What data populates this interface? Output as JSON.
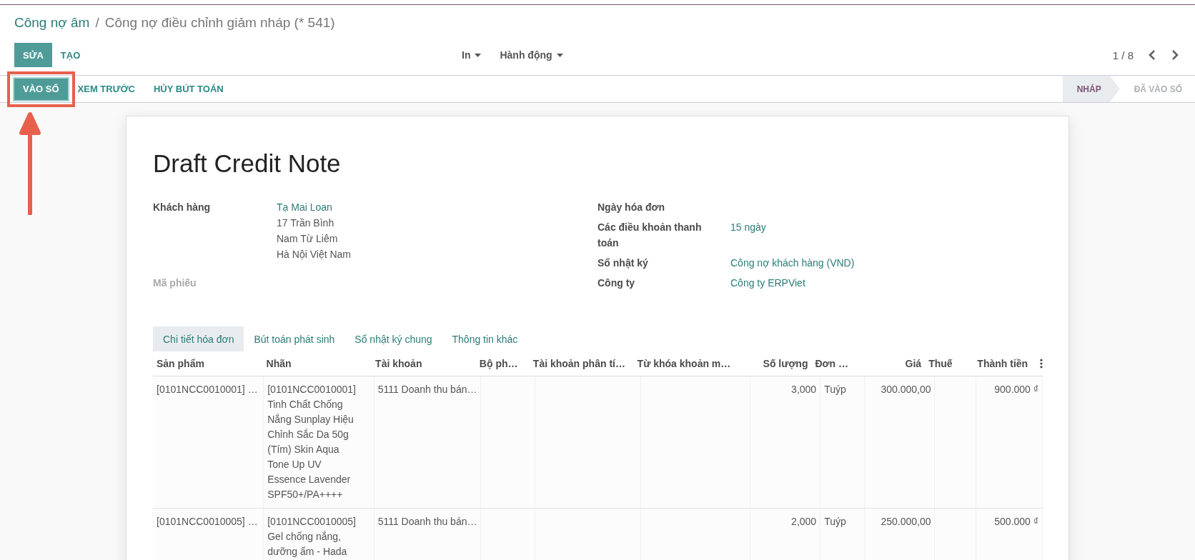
{
  "breadcrumb": {
    "parent": "Công nợ âm",
    "separator": "/",
    "current": "Công nợ điều chỉnh giảm nháp (* 541)"
  },
  "buttons": [
    {
      "label": "SỬA",
      "kind": "primary"
    },
    {
      "label": "TẠO",
      "kind": "link"
    }
  ],
  "dropdowns": [
    "In",
    "Hành động"
  ],
  "pager": "1 / 8",
  "actions": [
    {
      "label": "VÀO SỔ",
      "kind": "primary",
      "highlighted": true
    },
    {
      "label": "XEM TRƯỚC",
      "kind": "link",
      "highlighted": false
    },
    {
      "label": "HỦY BÚT TOÁN",
      "kind": "link",
      "highlighted": false
    }
  ],
  "statuses": [
    {
      "label": "NHÁP",
      "selected": true
    },
    {
      "label": "ĐÃ VÀO SỔ",
      "selected": false
    }
  ],
  "sheet": {
    "title": "Draft Credit Note",
    "left_fields": [
      {
        "label": "Khách hàng",
        "muted": false,
        "link": "Tạ Mai Loan",
        "lines": [
          "17 Trần Bình",
          "Nam Từ Liêm",
          "Hà Nội Việt Nam"
        ]
      },
      {
        "label": "Mã phiếu",
        "muted": true
      }
    ],
    "right_fields": [
      {
        "label": "Ngày hóa đơn"
      },
      {
        "label": "Các điều khoản thanh toán",
        "value": "15 ngày"
      },
      {
        "label": "Sổ nhật ký",
        "value": "Công nợ khách hàng (VND)"
      },
      {
        "label": "Công ty",
        "value": "Công ty ERPViet"
      }
    ],
    "tabs": [
      {
        "label": "Chi tiết hóa đơn",
        "selected": true
      },
      {
        "label": "Bút toán phát sinh",
        "selected": false
      },
      {
        "label": "Sổ nhật ký chung",
        "selected": false
      },
      {
        "label": "Thông tin khác",
        "selected": false
      }
    ],
    "table": {
      "columns": [
        {
          "label": "Sản phẩm",
          "numeric": false
        },
        {
          "label": "Nhãn",
          "numeric": false
        },
        {
          "label": "Tài khoản",
          "numeric": false
        },
        {
          "label": "Bộ ph…",
          "numeric": false
        },
        {
          "label": "Tài khoản phân tí…",
          "numeric": false
        },
        {
          "label": "Từ khóa khoản m…",
          "numeric": false
        },
        {
          "label": "Số lượng",
          "numeric": true
        },
        {
          "label": "Đơn …",
          "numeric": false
        },
        {
          "label": "Giá",
          "numeric": true
        },
        {
          "label": "Thuế",
          "numeric": false
        },
        {
          "label": "Thành tiền",
          "numeric": true
        }
      ],
      "rows": [
        {
          "cells": [
            "[0101NCC0010001] …",
            "[0101NCC0010001] Tinh Chất Chống Nắng Sunplay Hiệu Chỉnh Sắc Da 50g (Tím) Skin Aqua Tone Up UV Essence Lavender SPF50+/PA++++",
            "5111 Doanh thu bán…",
            null,
            null,
            null,
            "3,000",
            "Tuýp",
            "300.000,00",
            null,
            "900.000 ₫"
          ]
        },
        {
          "cells": [
            "[0101NCC0010005] …",
            "[0101NCC0010005] Gel chống nắng, dưỡng ẩm - Hada",
            "5111 Doanh thu bán…",
            null,
            null,
            null,
            "2,000",
            "Tuýp",
            "250.000,00",
            null,
            "500.000 ₫"
          ]
        }
      ]
    }
  }
}
